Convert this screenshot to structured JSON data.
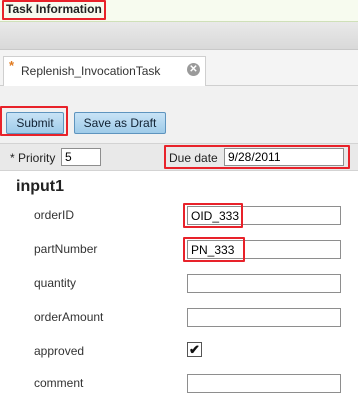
{
  "header": {
    "title": "Task Information"
  },
  "tabs": [
    {
      "label": "Replenish_InvocationTask",
      "modified_marker": "*",
      "close_icon": "close-circle-icon"
    }
  ],
  "toolbar": {
    "submit_label": "Submit",
    "draft_label": "Save as Draft"
  },
  "task_fields": {
    "priority_label": "* Priority",
    "priority_value": "5",
    "due_label": "Due date",
    "due_value": "9/28/2011"
  },
  "section": {
    "title": "input1",
    "fields": [
      {
        "label": "orderID",
        "value": "OID_333"
      },
      {
        "label": "partNumber",
        "value": "PN_333"
      },
      {
        "label": "quantity",
        "value": ""
      },
      {
        "label": "orderAmount",
        "value": ""
      },
      {
        "label": "approved",
        "checked": true,
        "check_mark": "✔"
      },
      {
        "label": "comment",
        "value": ""
      }
    ]
  },
  "colors": {
    "highlight": "#e8222a",
    "button": "#b4d8f1",
    "accent_star": "#e07a1f"
  }
}
